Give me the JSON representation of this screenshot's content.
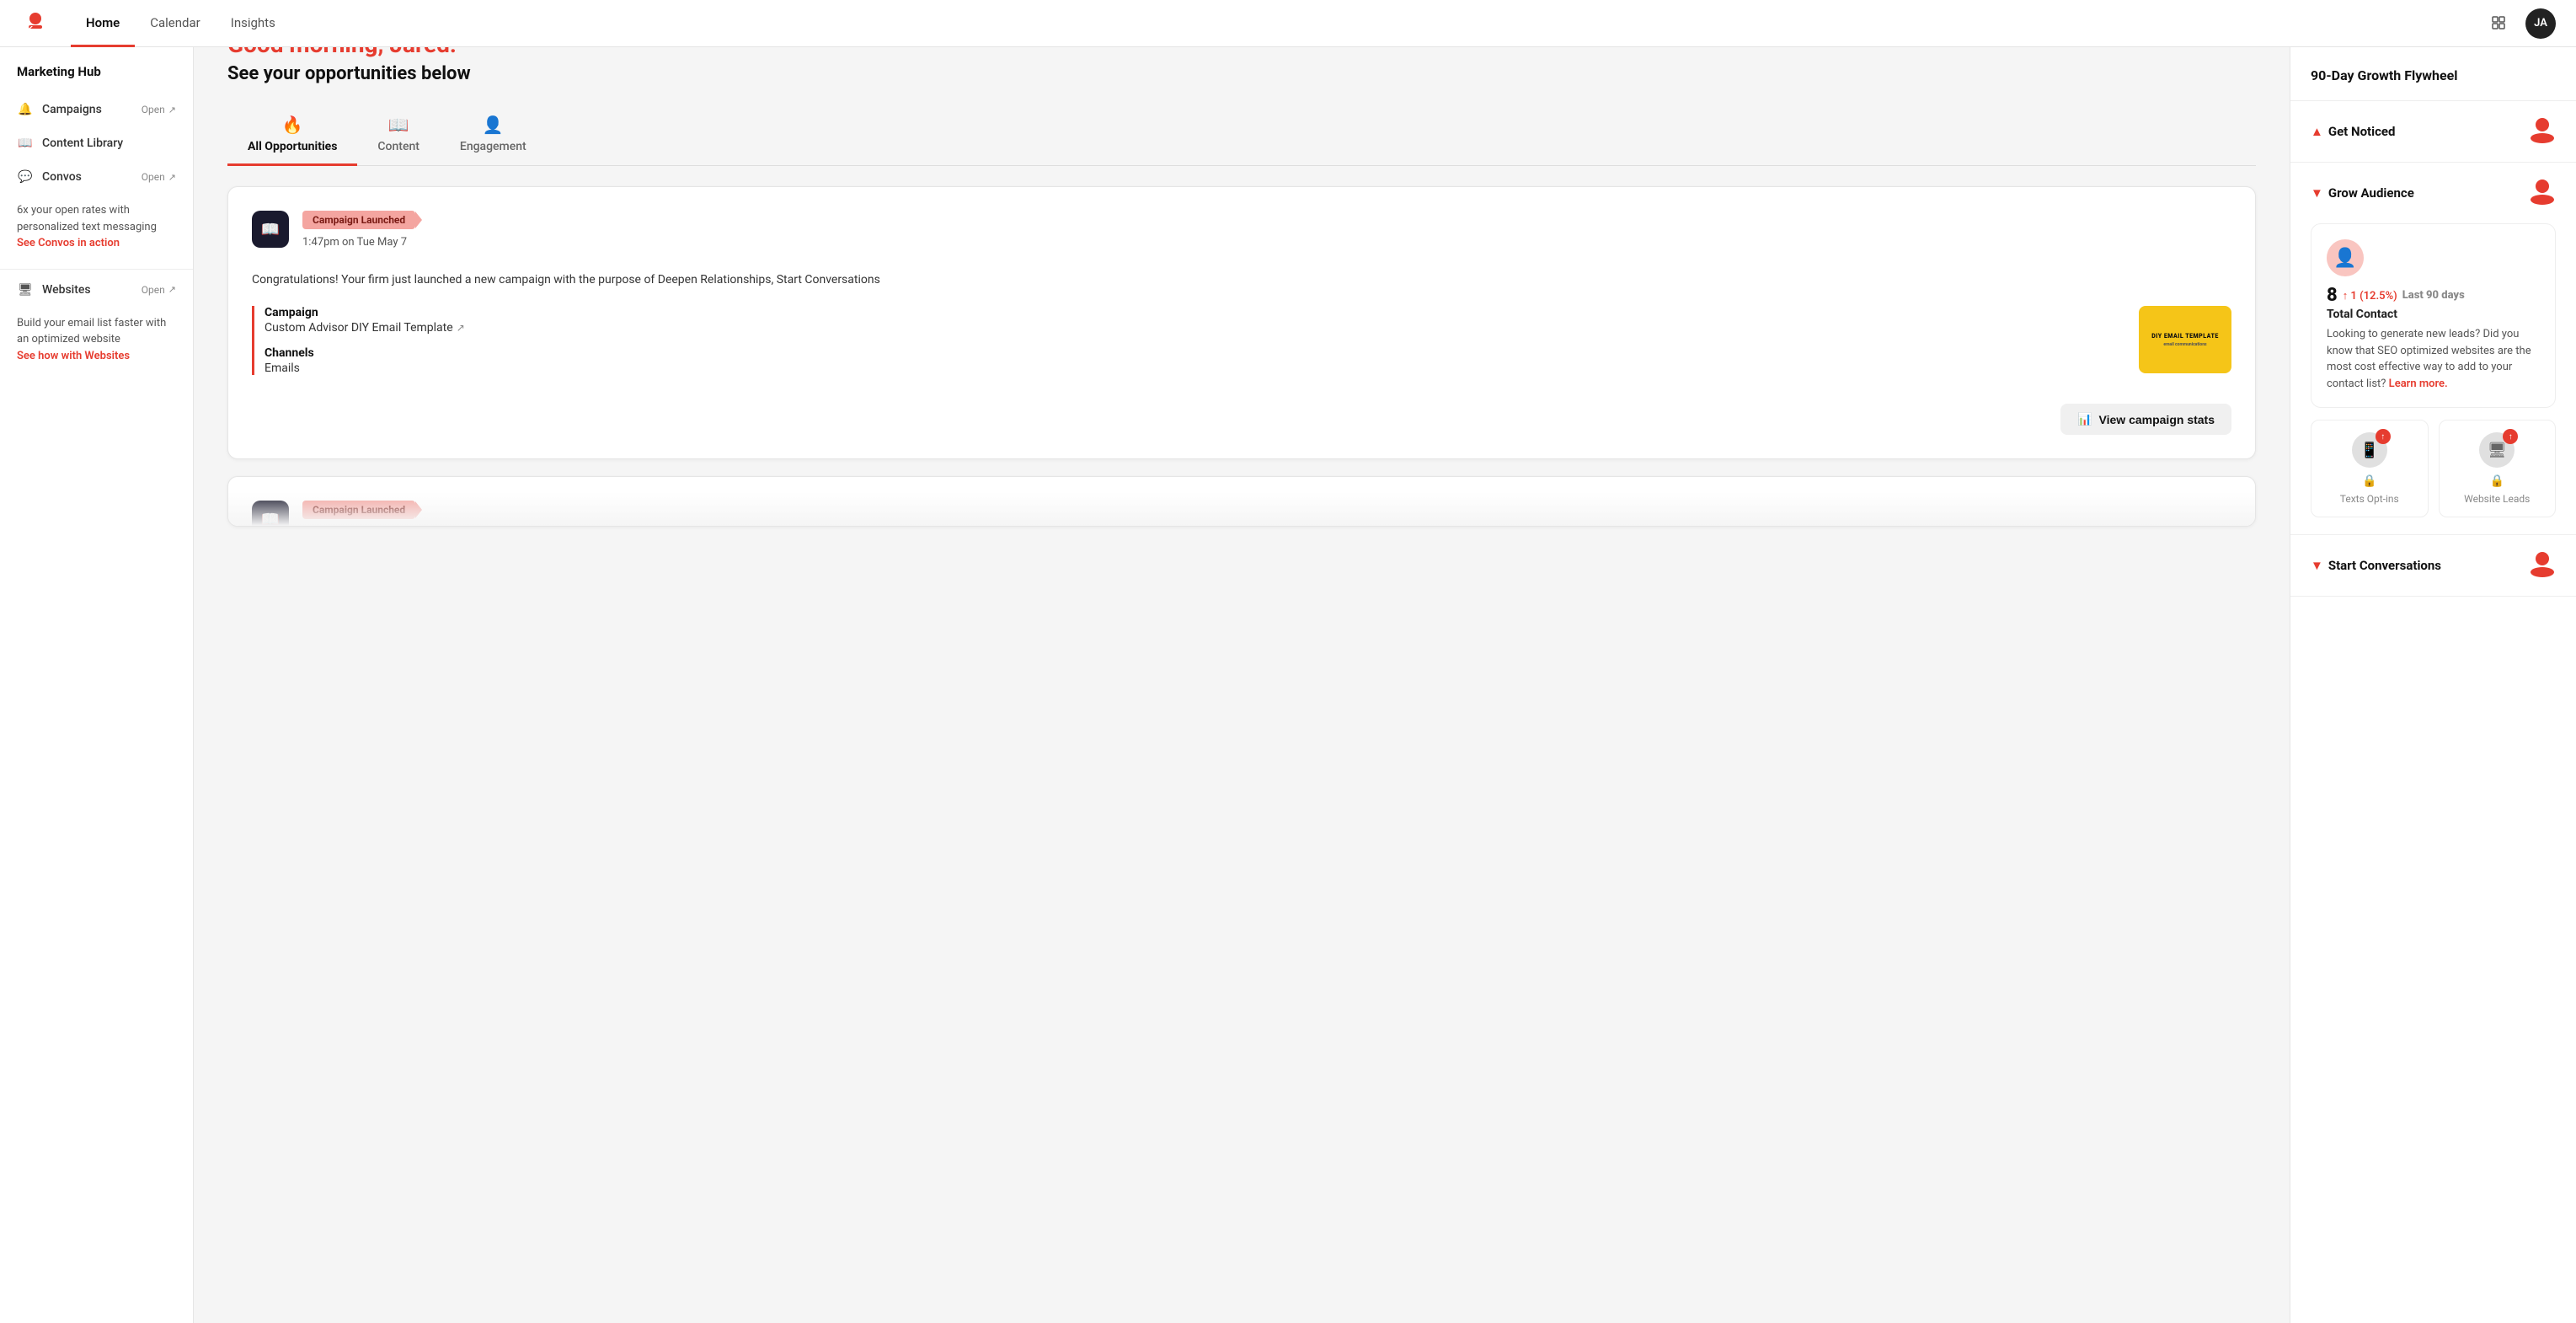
{
  "app": {
    "logo_alt": "Keap logo"
  },
  "nav": {
    "tabs": [
      {
        "id": "home",
        "label": "Home",
        "active": true
      },
      {
        "id": "calendar",
        "label": "Calendar",
        "active": false
      },
      {
        "id": "insights",
        "label": "Insights",
        "active": false
      }
    ],
    "avatar_initials": "JA"
  },
  "sidebar": {
    "title": "Marketing Hub",
    "items": [
      {
        "id": "campaigns",
        "icon": "🔔",
        "label": "Campaigns",
        "badge": "Open",
        "has_arrow": true
      },
      {
        "id": "content-library",
        "icon": "📖",
        "label": "Content Library",
        "badge": "",
        "has_arrow": false
      },
      {
        "id": "convos",
        "icon": "💬",
        "label": "Convos",
        "badge": "Open",
        "has_arrow": true
      }
    ],
    "convos_promo": "6x your open rates with personalized text messaging",
    "convos_promo_link": "See Convos in action",
    "websites_item": {
      "id": "websites",
      "icon": "🖥",
      "label": "Websites",
      "badge": "Open",
      "has_arrow": true
    },
    "websites_promo": "Build your email list faster with an optimized website",
    "websites_promo_link": "See how with Websites"
  },
  "main": {
    "greeting": "Good morning, Jared!",
    "sub_greeting": "See your opportunities below",
    "tabs": [
      {
        "id": "all",
        "label": "All Opportunities",
        "icon": "🔥",
        "active": true
      },
      {
        "id": "content",
        "label": "Content",
        "icon": "📖",
        "active": false
      },
      {
        "id": "engagement",
        "label": "Engagement",
        "icon": "👤",
        "active": false
      }
    ],
    "cards": [
      {
        "id": "campaign-launched",
        "icon": "📖",
        "badge": "Campaign Launched",
        "timestamp": "1:47pm on Tue May 7",
        "description": "Congratulations! Your firm just launched a new campaign with the purpose of Deepen Relationships, Start Conversations",
        "campaign_label": "Campaign",
        "campaign_value": "Custom Advisor DIY Email Template",
        "channels_label": "Channels",
        "channels_value": "Emails",
        "thumbnail_line1": "DIY EMAIL TEMPLATE",
        "thumbnail_line2": "email communications",
        "view_stats_label": "View campaign stats"
      }
    ],
    "partial_card_badge": "Campaign Launched"
  },
  "right_panel": {
    "title": "90-Day Growth Flywheel",
    "sections": [
      {
        "id": "get-noticed",
        "label": "Get Noticed",
        "expanded": false,
        "icon": "▲"
      },
      {
        "id": "grow-audience",
        "label": "Grow Audience",
        "expanded": true,
        "icon": "▼",
        "contact_count": "8",
        "contact_change": "↑ 1 (12.5%)",
        "contact_period": "Last 90 days",
        "contact_label": "Total Contact",
        "contact_desc": "Looking to generate new leads? Did you know that SEO optimized websites are the most cost effective way to add to your contact list?",
        "contact_link": "Learn more.",
        "sub_cards": [
          {
            "id": "texts-optins",
            "label": "Texts Opt-ins",
            "icon": "📱",
            "badge": "↑",
            "locked": true
          },
          {
            "id": "website-leads",
            "label": "Website Leads",
            "icon": "🖥",
            "badge": "↑",
            "locked": true
          }
        ]
      },
      {
        "id": "start-conversations",
        "label": "Start Conversations",
        "expanded": false,
        "icon": "▼"
      }
    ]
  }
}
